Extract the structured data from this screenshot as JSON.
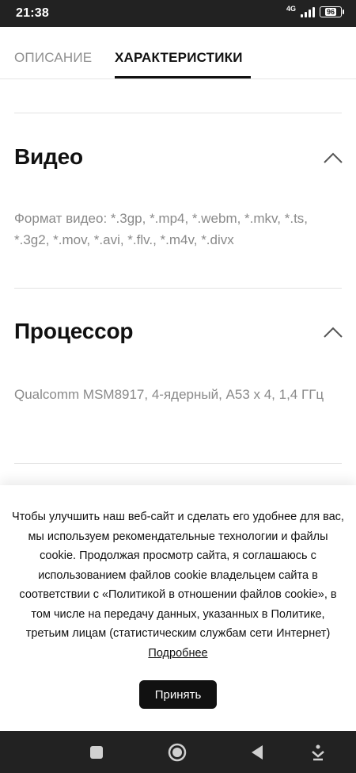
{
  "status_bar": {
    "time": "21:38",
    "network": "4G",
    "battery": "96"
  },
  "tabs": [
    {
      "label": "ОПИСАНИЕ",
      "active": false
    },
    {
      "label": "ХАРАКТЕРИСТИКИ",
      "active": true
    }
  ],
  "sections": [
    {
      "title": "Видео",
      "text": "Формат видео: *.3gp, *.mp4, *.webm, *.mkv, *.ts, *.3g2, *.mov, *.avi, *.flv., *.m4v, *.divx",
      "expanded": true
    },
    {
      "title": "Процессор",
      "text": "Qualcomm MSM8917, 4-ядерный, A53 x 4, 1,4 ГГц",
      "expanded": true
    }
  ],
  "cookie": {
    "text": "Чтобы улучшить наш веб-сайт и сделать его удобнее для вас, мы используем рекомендательные технологии и файлы cookie. Продолжая просмотр сайта, я соглашаюсь с использованием файлов cookie владельцем сайта в соответствии с «Политикой в отношении файлов cookie», в том числе на передачу данных, указанных в Политике, третьим лицам (статистическим службам сети Интернет)",
    "link_text": "Подробнее",
    "accept_label": "Принять"
  },
  "nav_bar": {
    "buttons": [
      "square-icon",
      "home-circle-icon",
      "back-triangle-icon",
      "download-icon"
    ]
  }
}
